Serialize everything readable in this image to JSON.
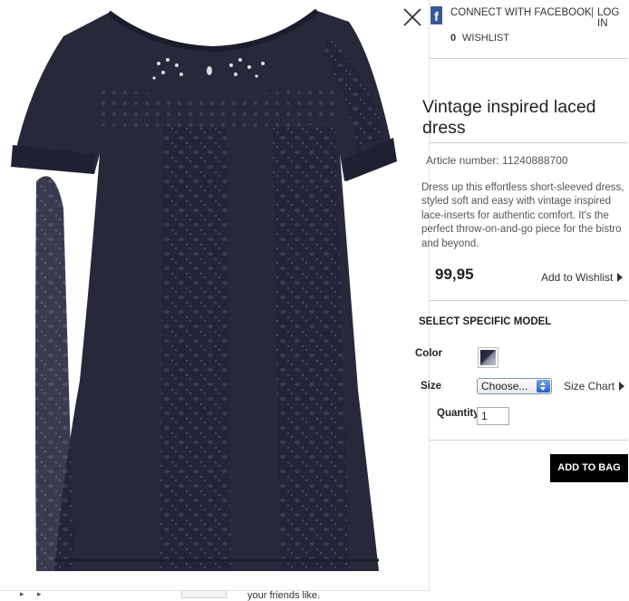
{
  "header": {
    "facebook_icon_glyph": "f",
    "facebook_connect": "CONNECT WITH FACEBOOK",
    "login_separator": "|",
    "login": "LOG IN",
    "wishlist_count": "0",
    "wishlist_label": "WISHLIST"
  },
  "product": {
    "title": "Vintage inspired laced dress",
    "article_number": "Article number: 11240888700",
    "description": "Dress up this effortless short-sleeved dress, styled soft and easy with vintage inspired lace-inserts for authentic comfort. It's the perfect throw-on-and-go piece for the bistro and beyond.",
    "price": "99,95",
    "add_to_wishlist": "Add to Wishlist",
    "image_icon": "navy-lace-dress-image"
  },
  "model_select": {
    "heading": "SELECT SPECIFIC MODEL",
    "color_label": "Color",
    "color_swatch": "navy",
    "size_label": "Size",
    "size_value": "Choose...",
    "size_chart": "Size Chart",
    "quantity_label": "Quantity",
    "quantity_value": "1"
  },
  "actions": {
    "add_to_bag": "ADD TO BAG"
  },
  "background_page": {
    "text": "your friends like."
  },
  "colors": {
    "dress": "#27283a",
    "facebook": "#3b5998",
    "button": "#000000"
  }
}
